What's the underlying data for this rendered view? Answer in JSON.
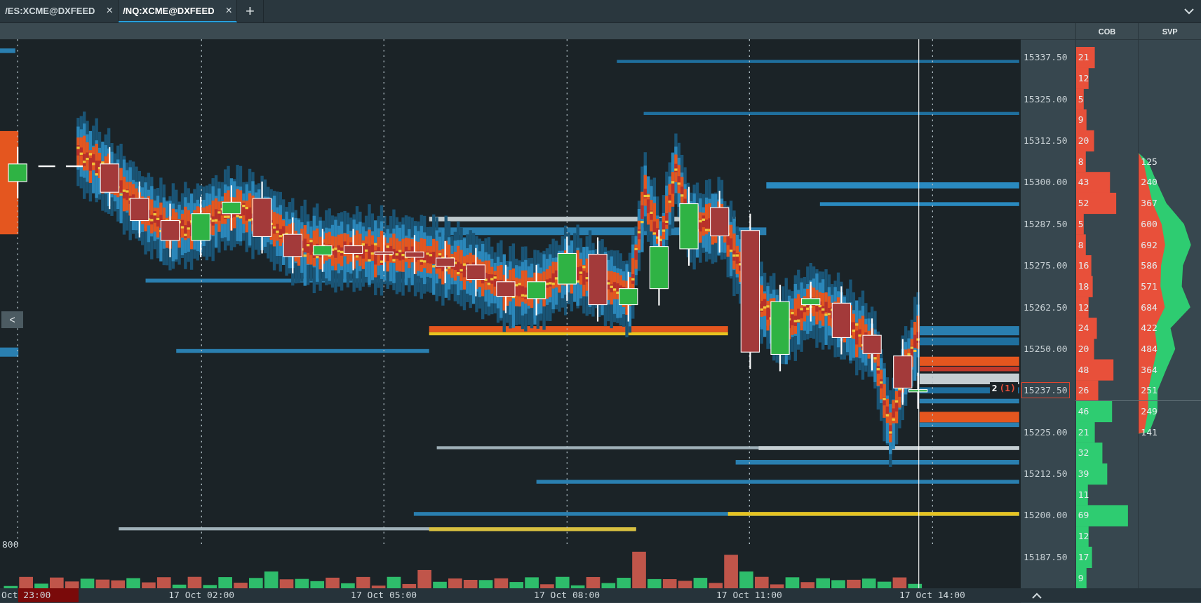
{
  "tabs": [
    {
      "label": "/ES:XCME@DXFEED",
      "selected": false,
      "close": "×"
    },
    {
      "label": "/NQ:XCME@DXFEED",
      "selected": true,
      "close": "×"
    }
  ],
  "add_tab": "+",
  "collapse_button": "<",
  "volume_scale": "800",
  "last_trade": {
    "size": "2",
    "count": "(1)"
  },
  "time_axis": [
    "Oct 23:00",
    "17 Oct 02:00",
    "17 Oct 05:00",
    "17 Oct 08:00",
    "17 Oct 11:00",
    "17 Oct 14:00"
  ],
  "ladder": {
    "columns": [
      "COB",
      "SVP"
    ],
    "rows": [
      {
        "price": "15337.50",
        "cob": "21",
        "kind": "ask",
        "current": false
      },
      {
        "cob": "12",
        "kind": "ask",
        "current": false
      },
      {
        "price": "15325.00",
        "cob": "5",
        "kind": "ask",
        "current": false
      },
      {
        "cob": "9",
        "kind": "ask",
        "current": false
      },
      {
        "price": "15312.50",
        "cob": "20",
        "kind": "ask",
        "current": false
      },
      {
        "cob": "8",
        "svp": "125",
        "kind": "ask",
        "current": false
      },
      {
        "price": "15300.00",
        "cob": "43",
        "svp": "240",
        "kind": "ask",
        "current": false
      },
      {
        "cob": "52",
        "svp": "367",
        "kind": "ask",
        "current": false
      },
      {
        "price": "15287.50",
        "cob": "5",
        "svp": "600",
        "kind": "ask",
        "current": false
      },
      {
        "cob": "8",
        "svp": "692",
        "kind": "ask",
        "current": false
      },
      {
        "price": "15275.00",
        "cob": "16",
        "svp": "586",
        "kind": "ask",
        "current": false
      },
      {
        "cob": "18",
        "svp": "571",
        "kind": "ask",
        "current": false
      },
      {
        "price": "15262.50",
        "cob": "12",
        "svp": "684",
        "kind": "ask",
        "current": false
      },
      {
        "cob": "24",
        "svp": "422",
        "kind": "ask",
        "current": false
      },
      {
        "price": "15250.00",
        "cob": "20",
        "svp": "484",
        "kind": "ask",
        "current": false
      },
      {
        "cob": "48",
        "svp": "364",
        "kind": "ask",
        "current": false
      },
      {
        "price": "15237.50",
        "cob": "26",
        "svp": "251",
        "kind": "ask",
        "current": true
      },
      {
        "cob": "46",
        "svp": "249",
        "kind": "bid",
        "current": false
      },
      {
        "price": "15225.00",
        "cob": "21",
        "svp": "141",
        "kind": "bid",
        "current": false
      },
      {
        "cob": "32",
        "kind": "bid",
        "current": false
      },
      {
        "price": "15212.50",
        "cob": "39",
        "kind": "bid",
        "current": false
      },
      {
        "cob": "11",
        "kind": "bid",
        "current": false
      },
      {
        "price": "15200.00",
        "cob": "69",
        "kind": "bid",
        "current": false
      },
      {
        "cob": "12",
        "kind": "bid",
        "current": false
      },
      {
        "price": "15187.50",
        "cob": "17",
        "kind": "bid",
        "current": false
      },
      {
        "cob": "9",
        "kind": "bid",
        "current": false
      }
    ]
  }
}
